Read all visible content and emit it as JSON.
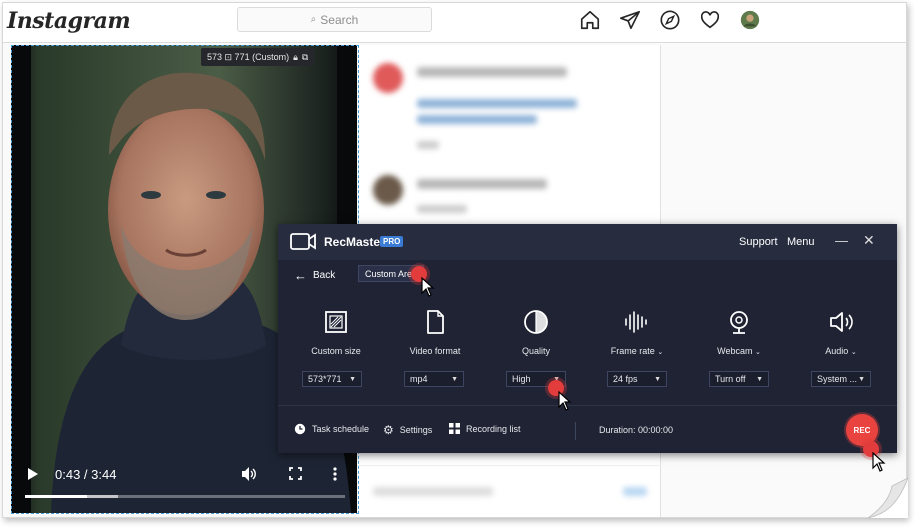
{
  "instagram": {
    "logo": "Instagram",
    "search_placeholder": "Search",
    "nav_icons": [
      "home-icon",
      "direct-icon",
      "explore-icon",
      "heart-icon",
      "profile-avatar"
    ]
  },
  "video": {
    "selection_size": "573 ⊡ 771  (Custom)",
    "time": "0:43 / 3:44",
    "progress_fraction": 0.195,
    "buffer_fraction": 0.29
  },
  "recmaster": {
    "app_name": "RecMaster",
    "badge": "PRO",
    "support": "Support",
    "menu": "Menu",
    "minimize": "—",
    "close": "✕",
    "back": "Back",
    "mode": "Custom Area",
    "options": [
      {
        "label": "Custom size",
        "value": "573*771",
        "icon": "custom-size-icon",
        "has_caret": false
      },
      {
        "label": "Video format",
        "value": "mp4",
        "icon": "file-icon",
        "has_caret": false
      },
      {
        "label": "Quality",
        "value": "High",
        "icon": "quality-icon",
        "has_caret": false
      },
      {
        "label": "Frame rate",
        "value": "24 fps",
        "icon": "frame-rate-icon",
        "has_caret": true
      },
      {
        "label": "Webcam",
        "value": "Turn off",
        "icon": "webcam-icon",
        "has_caret": true
      },
      {
        "label": "Audio",
        "value": "System ...",
        "icon": "speaker-icon",
        "has_caret": true
      }
    ],
    "footer": {
      "task_schedule": "Task schedule",
      "settings": "Settings",
      "recording_list": "Recording list",
      "duration": "Duration: 00:00:00",
      "rec": "REC"
    }
  },
  "colors": {
    "rec_bg": "#1f2333",
    "accent_red": "#e8433e",
    "pro_blue": "#3a7bd5",
    "selection_border": "#4a9fd6"
  }
}
